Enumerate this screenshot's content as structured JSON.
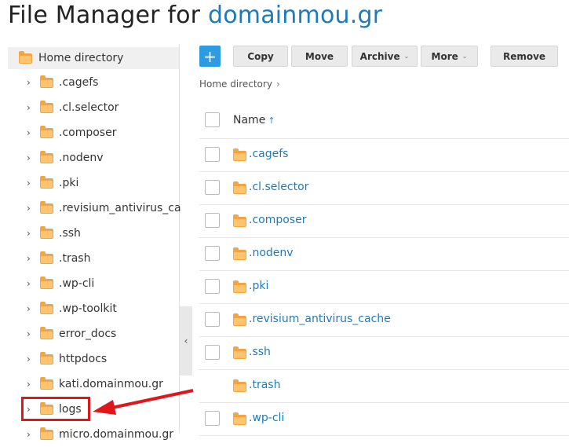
{
  "title": {
    "prefix": "File Manager for ",
    "domain": "domainmou.gr"
  },
  "sidebar": {
    "root_label": "Home directory",
    "items": [
      {
        "label": ".cagefs"
      },
      {
        "label": ".cl.selector"
      },
      {
        "label": ".composer"
      },
      {
        "label": ".nodenv"
      },
      {
        "label": ".pki"
      },
      {
        "label": ".revisium_antivirus_cache"
      },
      {
        "label": ".ssh"
      },
      {
        "label": ".trash"
      },
      {
        "label": ".wp-cli"
      },
      {
        "label": ".wp-toolkit"
      },
      {
        "label": "error_docs"
      },
      {
        "label": "httpdocs"
      },
      {
        "label": "kati.domainmou.gr"
      },
      {
        "label": "logs"
      },
      {
        "label": "micro.domainmou.gr"
      }
    ],
    "collapse_glyph": "‹"
  },
  "toolbar": {
    "add_label": "+",
    "copy": "Copy",
    "move": "Move",
    "archive": "Archive",
    "more": "More",
    "remove": "Remove"
  },
  "breadcrumb": {
    "label": "Home directory",
    "sep": "›"
  },
  "table": {
    "name_header": "Name",
    "sort_glyph": "↑",
    "rows": [
      {
        "name": ".cagefs",
        "checkbox": true
      },
      {
        "name": ".cl.selector",
        "checkbox": true
      },
      {
        "name": ".composer",
        "checkbox": true
      },
      {
        "name": ".nodenv",
        "checkbox": true
      },
      {
        "name": ".pki",
        "checkbox": true
      },
      {
        "name": ".revisium_antivirus_cache",
        "checkbox": true
      },
      {
        "name": ".ssh",
        "checkbox": true
      },
      {
        "name": ".trash",
        "checkbox": false
      },
      {
        "name": ".wp-cli",
        "checkbox": true
      }
    ]
  },
  "colors": {
    "accent": "#1f7ab8",
    "folder": "#f5a540",
    "highlight": "#e0161d",
    "add_button": "#2d9be0"
  }
}
